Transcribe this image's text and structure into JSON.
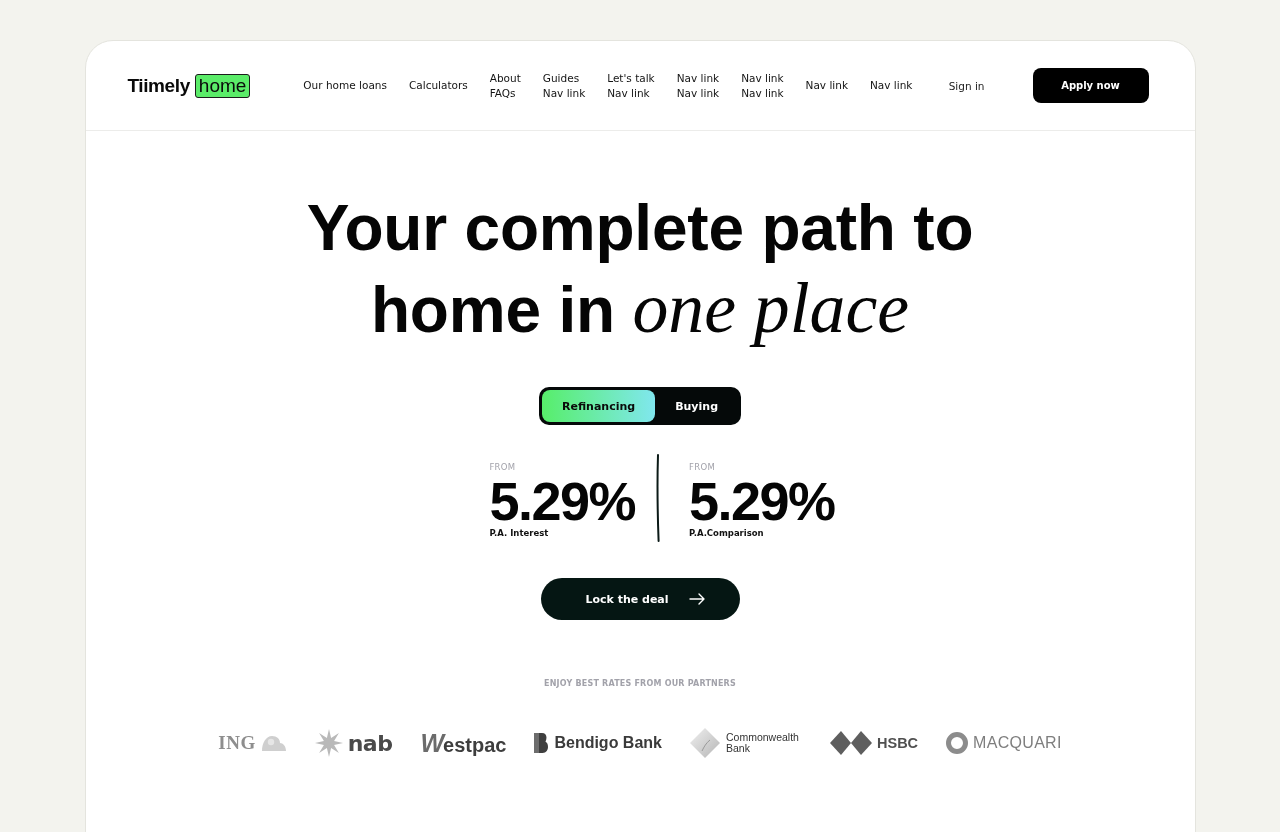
{
  "header": {
    "logo": {
      "wordmark": "Tiimely",
      "badge": "home"
    },
    "nav_links": [
      {
        "labels": [
          "Our home loans"
        ]
      },
      {
        "labels": [
          "Calculators"
        ]
      },
      {
        "labels": [
          "About",
          "FAQs"
        ]
      },
      {
        "labels": [
          "Guides",
          "Nav link"
        ]
      },
      {
        "labels": [
          "Let's talk",
          "Nav link"
        ]
      },
      {
        "labels": [
          "Nav link",
          "Nav link"
        ]
      },
      {
        "labels": [
          "Nav link",
          "Nav link"
        ]
      },
      {
        "labels": [
          "Nav link"
        ]
      },
      {
        "labels": [
          "Nav link"
        ]
      }
    ],
    "sign_in": "Sign in",
    "apply_button": "Apply now"
  },
  "hero": {
    "headline": "Your complete path to home in *one place*",
    "toggle": [
      {
        "label": "Refinancing",
        "selected": true
      },
      {
        "label": "Buying",
        "selected": false
      }
    ],
    "rates": [
      {
        "prefix": "FROM",
        "value": "5.29%",
        "caption": "P.A. Interest"
      },
      {
        "prefix": "FROM",
        "value": "5.29%",
        "caption": "P.A.Comparison"
      }
    ],
    "cta_button": "Lock the deal"
  },
  "partners": {
    "heading": "ENJOY BEST RATES FROM OUR PARTNERS",
    "logos": [
      {
        "name": "ING"
      },
      {
        "name": "nab"
      },
      {
        "name": "Westpac"
      },
      {
        "name": "Bendigo Bank"
      },
      {
        "name": "Commonwealth Bank"
      },
      {
        "name": "HSBC"
      },
      {
        "name": "MACQUARI"
      }
    ]
  }
}
